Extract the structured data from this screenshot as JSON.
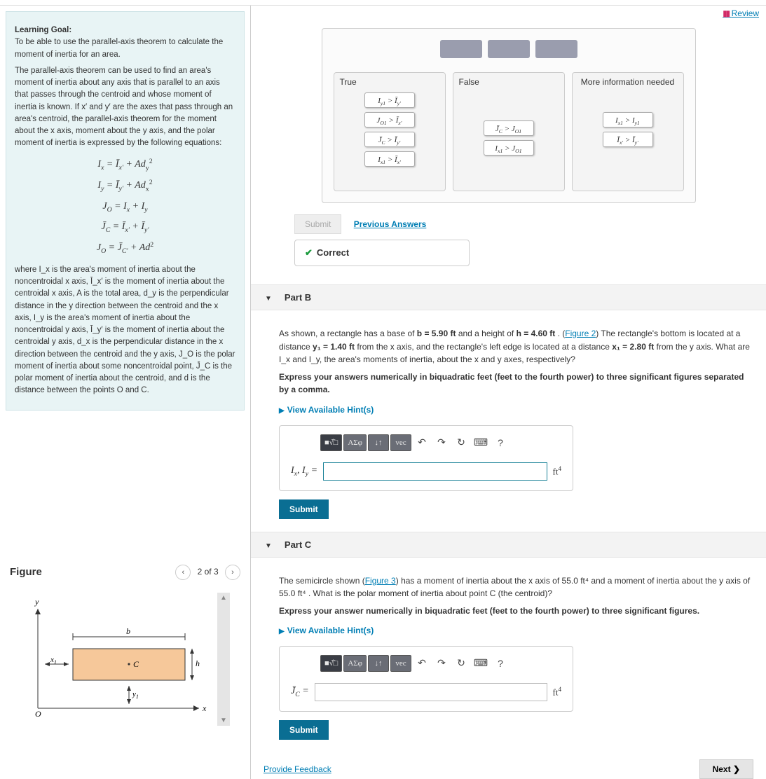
{
  "review_link": "Review",
  "learning_goal": {
    "heading": "Learning Goal:",
    "intro": "To be able to use the parallel-axis theorem to calculate the moment of inertia for an area.",
    "para1": "The parallel-axis theorem can be used to find an area's moment of inertia about any axis that is parallel to an axis that passes through the centroid and whose moment of inertia is known. If x′ and y′ are the axes that pass through an area's centroid, the parallel-axis theorem for the moment about the x axis, moment about the y axis, and the polar moment of inertia is expressed by the following equations:",
    "formulas": [
      "I_x = Ī_x′ + A d_y²",
      "I_y = Ī_y′ + A d_x²",
      "J_O = I_x + I_y",
      "J̄_C = Ī_x′ + Ī_y′",
      "J_O = J̄_C′ + A d²"
    ],
    "para2": "where I_x is the area's moment of inertia about the noncentroidal x axis, Ī_x′ is the moment of inertia about the centroidal x axis, A is the total area, d_y is the perpendicular distance in the y direction between the centroid and the x axis, I_y is the area's moment of inertia about the noncentroidal y axis, Ī_y′ is the moment of inertia about the centroidal y axis, d_x is the perpendicular distance in the x direction between the centroid and the y axis, J_O is the polar moment of inertia about some noncentroidal point, J̄_C is the polar moment of inertia about the centroid, and d is the distance between the points O and C."
  },
  "figure": {
    "title": "Figure",
    "pager": "2 of 3"
  },
  "sort": {
    "bins": [
      {
        "title": "True",
        "chips": [
          "I_y1 > Ī_y′",
          "J_O1 > Ī_x′",
          "J̄_C > Ī_y′",
          "I_x1 > Ī_x′"
        ]
      },
      {
        "title": "False",
        "chips": [
          "J̄_C > J_O1",
          "I_x1 > J_O1"
        ]
      },
      {
        "title": "More information needed",
        "chips": [
          "I_x1 > I_y1",
          "Ī_x′ > Ī_y′"
        ]
      }
    ]
  },
  "submit_g": "Submit",
  "prev": "Previous Answers",
  "correct": "Correct",
  "partB": {
    "title": "Part B",
    "text1a": "As shown, a rectangle has a base of ",
    "b_val": "b = 5.90 ft",
    "text1b": " and a height of ",
    "h_val": "h = 4.60 ft",
    "text1c": " . (",
    "fig_link": "Figure 2",
    "text1d": ") The rectangle's bottom is located at a distance ",
    "y1_val": "y₁ = 1.40 ft",
    "text1e": " from the x axis, and the rectangle's left edge is located at a distance ",
    "x1_val": "x₁ = 2.80 ft",
    "text1f": " from the y axis. What are I_x and I_y, the area's moments of inertia, about the x and y axes, respectively?",
    "instr": "Express your answers numerically in biquadratic feet (feet to the fourth power) to three significant figures separated by a comma.",
    "hints": "View Available Hint(s)",
    "label": "I_x, I_y =",
    "unit": "ft⁴",
    "submit": "Submit"
  },
  "partC": {
    "title": "Part C",
    "text1a": "The semicircle shown (",
    "fig_link": "Figure 3",
    "text1b": ") has a moment of inertia about the x axis of 55.0 ft⁴ and a moment of inertia about the y axis of 55.0 ft⁴ . What is the polar moment of inertia about point C (the centroid)?",
    "instr": "Express your answer numerically in biquadratic feet (feet to the fourth power) to three significant figures.",
    "hints": "View Available Hint(s)",
    "label": "J̄_C =",
    "unit": "ft⁴",
    "submit": "Submit"
  },
  "feedback": "Provide Feedback",
  "next": "Next ❯",
  "toolbar": {
    "b1": "■√̅□",
    "b2": "ΑΣφ",
    "b3": "↓↑",
    "b4": "vec"
  }
}
